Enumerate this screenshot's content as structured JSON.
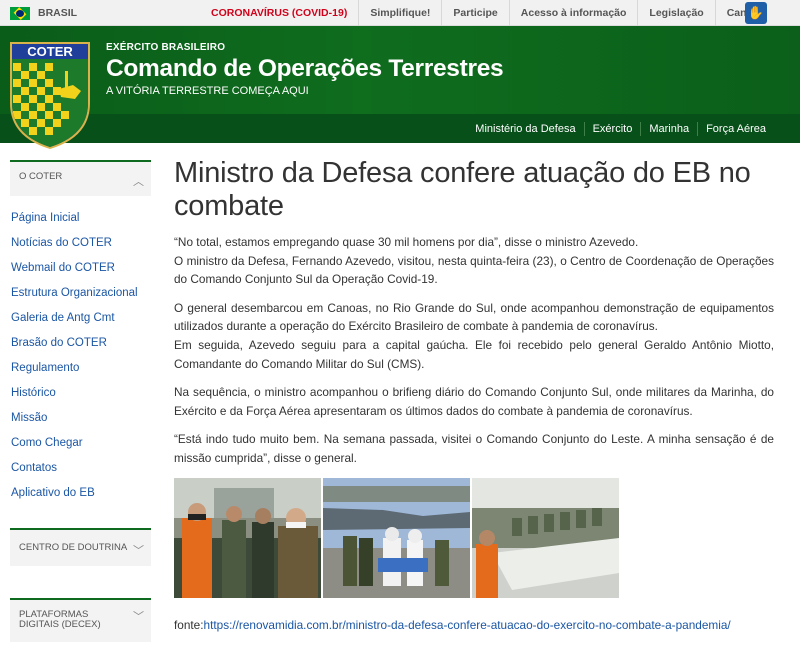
{
  "govbar": {
    "country": "BRASIL",
    "links": [
      "CORONAVÍRUS (COVID-19)",
      "Simplifique!",
      "Participe",
      "Acesso à informação",
      "Legislação",
      "Canais"
    ],
    "accessibility_icon": "vlibras-hands-icon"
  },
  "header": {
    "org": "EXÉRCITO BRASILEIRO",
    "title": "Comando de Operações Terrestres",
    "slogan": "A VITÓRIA TERRESTRE COMEÇA AQUI",
    "shield_text": "COTER",
    "nav": [
      "Ministério da Defesa",
      "Exército",
      "Marinha",
      "Força Aérea"
    ]
  },
  "sidebar": {
    "section1_title": "O COTER",
    "items": [
      "Página Inicial",
      "Notícias do COTER",
      "Webmail do COTER",
      "Estrutura Organizacional",
      "Galeria de Antg Cmt",
      "Brasão do COTER",
      "Regulamento",
      "Histórico",
      "Missão",
      "Como Chegar",
      "Contatos",
      "Aplicativo do EB"
    ],
    "section2_title": "CENTRO DE DOUTRINA",
    "section3_title": "PLATAFORMAS DIGITAIS (DECEX)"
  },
  "article": {
    "title": "Ministro da Defesa confere atuação do EB no combate",
    "p1a": "“No total, estamos empregando quase 30 mil homens por dia”, disse o ministro Azevedo.",
    "p1b": "O ministro da Defesa, Fernando Azevedo, visitou, nesta quinta-feira (23), o Centro de Coordenação de Operações do Comando Conjunto Sul da Operação Covid-19.",
    "p2a": "O general desembarcou em Canoas, no Rio Grande do Sul, onde acompanhou demonstração de equipamentos utilizados durante a operação do Exército Brasileiro de combate à pandemia de coronavírus.",
    "p2b": "Em seguida, Azevedo seguiu para a capital gaúcha. Ele foi recebido pelo general Geraldo Antônio Miotto, Comandante do Comando Militar do Sul (CMS).",
    "p3": "Na sequência, o ministro acompanhou o brifieng diário do Comando Conjunto Sul, onde militares da Marinha, do Exército e da Força Aérea apresentaram os últimos dados do combate à pandemia de coronavírus.",
    "p4": "“Está indo tudo muito bem. Na semana passada, visitei o Comando Conjunto do Leste. A minha sensação é de missão cumprida”, disse o general.",
    "source_label": "fonte:",
    "source_url": "https://renovamidia.com.br/ministro-da-defesa-confere-atuacao-do-exercito-no-combate-a-pandemia/"
  }
}
